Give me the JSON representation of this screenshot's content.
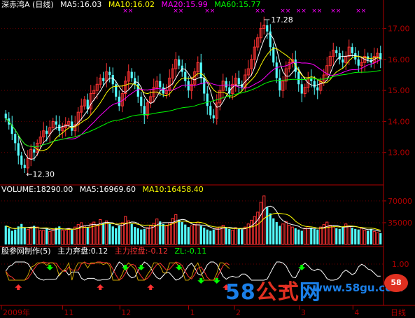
{
  "header": {
    "title": "深赤湾A (日线)",
    "ma5": "MA5:16.03",
    "ma10": "MA10:16.02",
    "ma20": "MA20:15.99",
    "ma60": "MA60:15.77"
  },
  "volume_header": {
    "volume": "VOLUME:18290.00",
    "ma5": "MA5:16969.60",
    "ma10": "MA10:16458.40"
  },
  "indicator_header": {
    "name": "股参网制作(5)",
    "zhuli_qipan": "主力弃盘:0.12",
    "zhuli_kongpan": "主力控盘:-0.12",
    "zl": "ZL:-0.11"
  },
  "x_axis_labels": [
    "2009年",
    "11",
    "12",
    "1",
    "2",
    "3",
    "4",
    "日线"
  ],
  "watermark": {
    "part1": "58",
    "part2": "公式",
    "part3": "网",
    "url": "www.58gu.com",
    "badge": "58"
  },
  "colors": {
    "up": "#ff3232",
    "down": "#54ffff",
    "ma5": "#ffffff",
    "ma10": "#ffff00",
    "ma20": "#ff00ff",
    "ma60": "#00ff00",
    "axis": "#b00000",
    "arrow_up": "#ff3030",
    "arrow_down": "#00ff00"
  },
  "chart_data": [
    {
      "type": "candlestick",
      "title": "深赤湾A (日线)",
      "ylim": [
        12.0,
        17.6
      ],
      "y_ticks": [
        13.0,
        14.0,
        15.0,
        16.0,
        17.0
      ],
      "y_tick_labels": [
        "13.00",
        "14.00",
        "15.00",
        "16.00",
        "17.00"
      ],
      "annotations": [
        {
          "label": "17.28",
          "note": "high"
        },
        {
          "label": "←12.30",
          "note": "low"
        }
      ],
      "close": [
        14.1,
        13.9,
        13.6,
        13.3,
        12.9,
        12.6,
        12.5,
        12.8,
        13.1,
        13.0,
        13.3,
        13.5,
        13.7,
        13.6,
        13.8,
        14.0,
        13.9,
        13.7,
        13.8,
        13.9,
        14.0,
        13.7,
        13.9,
        14.3,
        14.5,
        14.7,
        14.4,
        14.9,
        15.0,
        15.2,
        15.4,
        15.3,
        15.6,
        15.5,
        15.2,
        14.8,
        14.5,
        14.9,
        15.3,
        15.6,
        15.4,
        15.2,
        14.8,
        14.5,
        14.2,
        14.6,
        14.8,
        15.1,
        15.3,
        15.1,
        14.9,
        15.0,
        15.4,
        15.7,
        16.0,
        15.8,
        15.6,
        15.3,
        15.0,
        15.2,
        15.6,
        15.9,
        15.4,
        14.9,
        14.5,
        14.2,
        14.1,
        14.6,
        15.0,
        15.3,
        15.1,
        14.9,
        15.2,
        15.4,
        15.2,
        15.1,
        15.5,
        15.7,
        16.0,
        16.4,
        16.7,
        17.0,
        17.1,
        16.9,
        16.4,
        15.9,
        15.4,
        15.0,
        15.3,
        15.7,
        15.9,
        16.0,
        15.6,
        15.2,
        14.9,
        15.1,
        15.4,
        15.3,
        15.1,
        15.0,
        15.3,
        15.5,
        15.8,
        16.1,
        16.3,
        16.2,
        16.0,
        15.9,
        16.1,
        16.4,
        16.2,
        16.0,
        15.8,
        15.9,
        16.1,
        16.0,
        15.9,
        16.1,
        16.2,
        16.0
      ],
      "series": [
        {
          "name": "MA5",
          "value_last": 16.03
        },
        {
          "name": "MA10",
          "value_last": 16.02
        },
        {
          "name": "MA20",
          "value_last": 15.99
        },
        {
          "name": "MA60",
          "value_last": 15.77
        }
      ]
    },
    {
      "type": "bar",
      "title": "VOLUME",
      "ylim": [
        0,
        80000
      ],
      "y_ticks": [
        35000,
        70000
      ],
      "y_tick_labels": [
        "35000",
        "70000"
      ],
      "values": [
        30000,
        26000,
        22000,
        24000,
        29000,
        33000,
        27000,
        24000,
        26000,
        30000,
        28000,
        22000,
        23000,
        25000,
        21000,
        24000,
        27000,
        29000,
        23000,
        22000,
        26000,
        24000,
        28000,
        32000,
        35000,
        30000,
        28000,
        33000,
        36000,
        31000,
        40000,
        34000,
        38000,
        33000,
        29000,
        26000,
        30000,
        35000,
        45000,
        38000,
        33000,
        28000,
        26000,
        24000,
        25000,
        27000,
        30000,
        34000,
        41000,
        37000,
        33000,
        30000,
        35000,
        42000,
        48000,
        40000,
        36000,
        32000,
        28000,
        30000,
        32000,
        36000,
        30000,
        27000,
        24000,
        22000,
        24000,
        26000,
        28000,
        31000,
        27000,
        25000,
        23000,
        27000,
        25000,
        24000,
        28000,
        33000,
        39000,
        45000,
        52000,
        68000,
        78000,
        60000,
        50000,
        42000,
        36000,
        30000,
        33000,
        37000,
        31000,
        28000,
        26000,
        24000,
        22000,
        26000,
        29000,
        27000,
        25000,
        24000,
        28000,
        32000,
        36000,
        31000,
        28000,
        26000,
        25000,
        29000,
        33000,
        30000,
        27000,
        25000,
        24000,
        26000,
        23000,
        22000,
        25000,
        21000,
        19000,
        18290
      ],
      "series": [
        {
          "name": "MA5",
          "value_last": 16969.6
        },
        {
          "name": "MA10",
          "value_last": 16458.4
        }
      ]
    },
    {
      "type": "line",
      "title": "股参网制作(5)",
      "y_ticks": [
        1.0
      ],
      "y_tick_labels": [
        "1.00"
      ],
      "series": [
        {
          "name": "主力弃盘",
          "value_last": 0.12
        },
        {
          "name": "主力控盘",
          "value_last": -0.12
        },
        {
          "name": "ZL",
          "value_last": -0.11
        }
      ]
    }
  ]
}
